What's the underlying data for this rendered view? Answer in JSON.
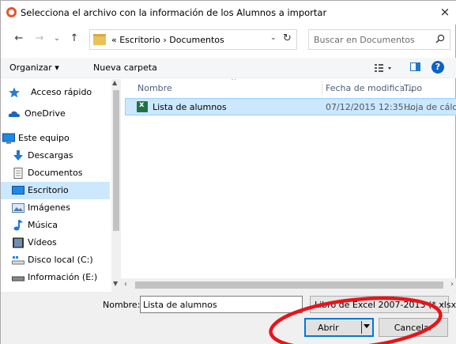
{
  "window": {
    "title": "Selecciona el archivo con la información de los Alumnos a importar",
    "close": "×"
  },
  "address": {
    "back": "←",
    "forward": "→",
    "history": "⌄",
    "up": "↑",
    "crumbs": "«  Escritorio  ›  Documentos",
    "dropdown": "⌄",
    "refresh": "↻",
    "search_placeholder": "Buscar en Documentos"
  },
  "toolbar": {
    "organize": "Organizar ▾",
    "new_folder": "Nueva carpeta",
    "help": "?"
  },
  "nav": {
    "items": [
      {
        "label": "Acceso rápido",
        "icon": "star-icon"
      },
      {
        "label": "OneDrive",
        "icon": "cloud-icon"
      },
      {
        "label": "Este equipo",
        "icon": "computer-icon"
      },
      {
        "label": "Descargas",
        "icon": "download-icon"
      },
      {
        "label": "Documentos",
        "icon": "document-icon"
      },
      {
        "label": "Escritorio",
        "icon": "desktop-icon"
      },
      {
        "label": "Imágenes",
        "icon": "image-icon"
      },
      {
        "label": "Música",
        "icon": "music-icon"
      },
      {
        "label": "Vídeos",
        "icon": "video-icon"
      },
      {
        "label": "Disco local (C:)",
        "icon": "drive-icon"
      },
      {
        "label": "Información (E:)",
        "icon": "drive-icon"
      }
    ],
    "selected": "Escritorio"
  },
  "columns": {
    "name": "Nombre",
    "date": "Fecha de modifica...",
    "type": "Tipo"
  },
  "files": [
    {
      "name": "Lista de alumnos",
      "date": "07/12/2015 12:35 ...",
      "type": "Hoja de cálc"
    }
  ],
  "bottom": {
    "filename_label": "Nombre:",
    "filename_value": "Lista de alumnos",
    "filter": "Libro de Excel 2007-2013 (*.xlsx)",
    "open": "Abrir",
    "cancel": "Cancelar"
  },
  "colors": {
    "selection": "#cce8ff",
    "accent": "#0078d7",
    "annotation": "#e8141b"
  }
}
